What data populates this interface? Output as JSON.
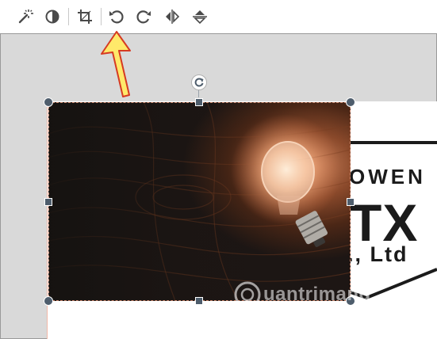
{
  "toolbar": {
    "icons": [
      "magic-wand-icon",
      "contrast-icon",
      "crop-icon",
      "rotate-left-icon",
      "rotate-right-icon",
      "flip-horizontal-icon",
      "flip-vertical-icon"
    ]
  },
  "canvas": {
    "logo_lines": [
      "OWEN",
      "TX",
      "., Ltd"
    ]
  },
  "annotation": {
    "arrow_color": "#ffe96a",
    "arrow_stroke": "#d63a22",
    "points_to": "rotate-left-icon"
  },
  "watermark": {
    "text": "uantrimang",
    "icon": "quantrimang-logo-icon"
  },
  "colors": {
    "handle": "#4e5d6c",
    "selection": "#c8846a",
    "toolbar_icon": "#4a4a4a"
  }
}
